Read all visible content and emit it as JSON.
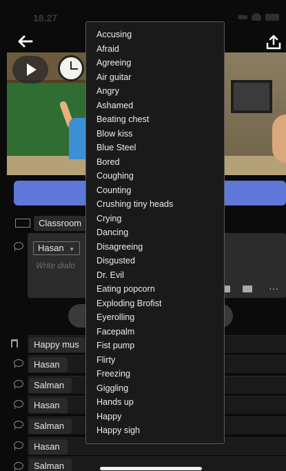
{
  "status_bar": {
    "time": "18.27"
  },
  "main": {
    "scene_label": "Classroom",
    "dialog": {
      "speaker": "Hasan",
      "placeholder": "Write dialo"
    },
    "rows": [
      {
        "type": "music",
        "label": "Happy mus"
      },
      {
        "type": "dialog",
        "label": "Hasan"
      },
      {
        "type": "dialog",
        "label": "Salman"
      },
      {
        "type": "dialog",
        "label": "Hasan"
      },
      {
        "type": "dialog",
        "label": "Salman"
      },
      {
        "type": "dialog",
        "label": "Hasan"
      },
      {
        "type": "dialog",
        "label": "Salman"
      }
    ]
  },
  "action_menu": {
    "items": [
      "Accusing",
      "Afraid",
      "Agreeing",
      "Air guitar",
      "Angry",
      "Ashamed",
      "Beating chest",
      "Blow kiss",
      "Blue Steel",
      "Bored",
      "Coughing",
      "Counting",
      "Crushing tiny heads",
      "Crying",
      "Dancing",
      "Disagreeing",
      "Disgusted",
      "Dr. Evil",
      "Eating popcorn",
      "Exploding Brofist",
      "Eyerolling",
      "Facepalm",
      "Fist pump",
      "Flirty",
      "Freezing",
      "Giggling",
      "Hands up",
      "Happy",
      "Happy sigh"
    ]
  },
  "colors": {
    "accent": "#5d78d8",
    "background": "#0b0b0b",
    "menu_bg": "#1a1a1a"
  }
}
